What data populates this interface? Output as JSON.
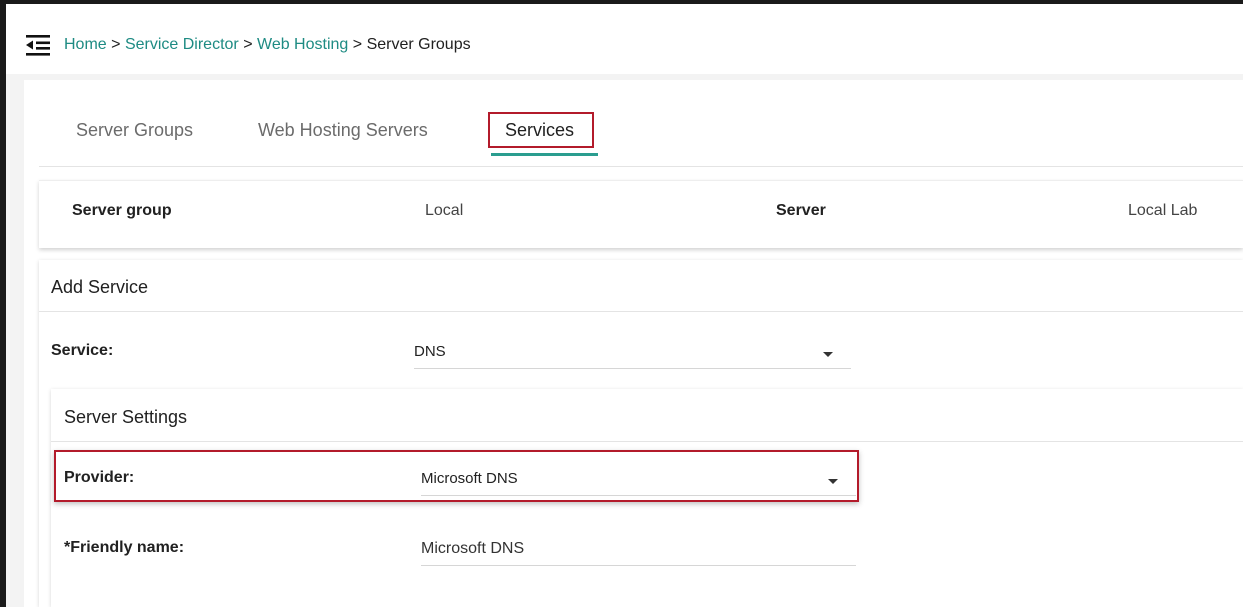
{
  "breadcrumb": {
    "home": "Home",
    "sep": ">",
    "service_director": "Service Director",
    "web_hosting": "Web Hosting",
    "current": "Server Groups"
  },
  "tabs": [
    {
      "label": "Server Groups",
      "active": false
    },
    {
      "label": "Web Hosting Servers",
      "active": false
    },
    {
      "label": "Services",
      "active": true
    }
  ],
  "info": {
    "server_group_label": "Server group",
    "server_group_value": "Local",
    "server_label": "Server",
    "server_value": "Local Lab"
  },
  "add_service": {
    "title": "Add Service",
    "service_label": "Service:",
    "service_value": "DNS"
  },
  "server_settings": {
    "title": "Server Settings",
    "provider_label": "Provider:",
    "provider_value": "Microsoft DNS",
    "friendly_name_label": "*Friendly name:",
    "friendly_name_value": "Microsoft DNS"
  },
  "colors": {
    "link": "#1e8b83",
    "tab_underline": "#2a9d8f",
    "highlight": "#b31b2b"
  }
}
